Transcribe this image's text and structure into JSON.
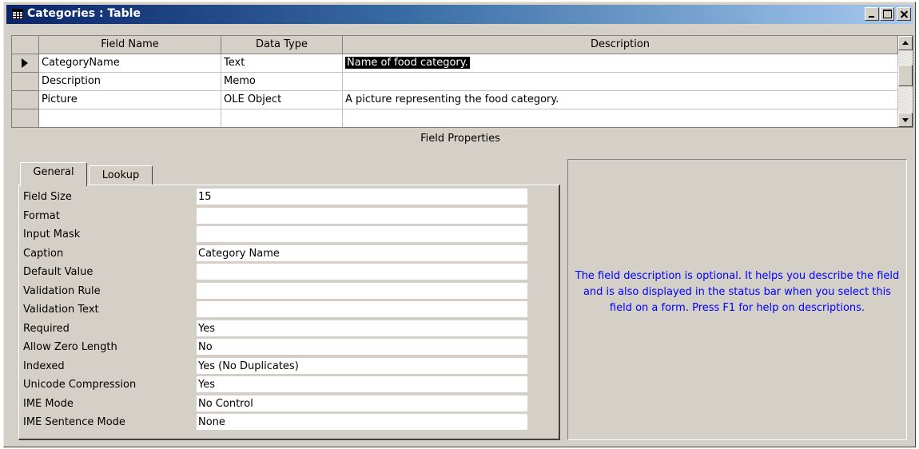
{
  "window": {
    "title": "Categories : Table"
  },
  "grid": {
    "columns": [
      "Field Name",
      "Data Type",
      "Description"
    ],
    "rows": [
      {
        "field_name": "CategoryName",
        "data_type": "Text",
        "description": "Name of food category."
      },
      {
        "field_name": "Description",
        "data_type": "Memo",
        "description": ""
      },
      {
        "field_name": "Picture",
        "data_type": "OLE Object",
        "description": "A picture representing the food category."
      },
      {
        "field_name": "",
        "data_type": "",
        "description": ""
      }
    ]
  },
  "field_properties_label": "Field Properties",
  "tabs": {
    "general": "General",
    "lookup": "Lookup"
  },
  "properties": [
    {
      "label": "Field Size",
      "value": "15"
    },
    {
      "label": "Format",
      "value": ""
    },
    {
      "label": "Input Mask",
      "value": ""
    },
    {
      "label": "Caption",
      "value": "Category Name"
    },
    {
      "label": "Default Value",
      "value": ""
    },
    {
      "label": "Validation Rule",
      "value": ""
    },
    {
      "label": "Validation Text",
      "value": ""
    },
    {
      "label": "Required",
      "value": "Yes"
    },
    {
      "label": "Allow Zero Length",
      "value": "No"
    },
    {
      "label": "Indexed",
      "value": "Yes (No Duplicates)"
    },
    {
      "label": "Unicode Compression",
      "value": "Yes"
    },
    {
      "label": "IME Mode",
      "value": "No Control"
    },
    {
      "label": "IME Sentence Mode",
      "value": "None"
    }
  ],
  "help_text": "The field description is optional.  It helps you describe the field and is also displayed in the status bar when you select this field on a form.  Press F1 for help on descriptions.",
  "colors": {
    "title_gradient_start": "#0a246a",
    "title_gradient_end": "#a6caf0",
    "face": "#d4d0c8",
    "help_text": "#0000ff",
    "selection": "#000000"
  }
}
